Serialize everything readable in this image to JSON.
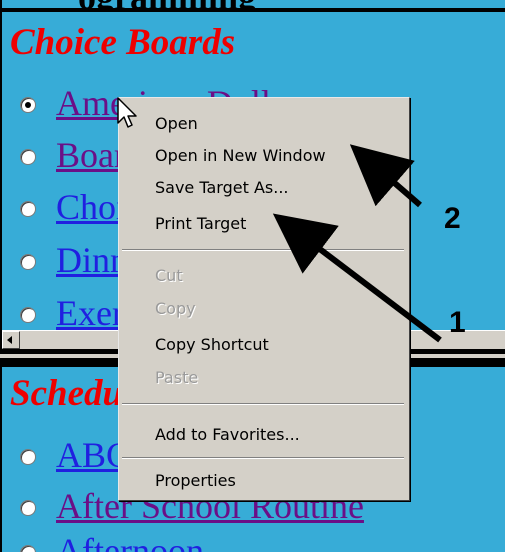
{
  "top_partial_text": "ogramming",
  "sections": [
    {
      "heading": "Choice Boards",
      "items": [
        {
          "label": "American Dolls",
          "selected": true,
          "visited": true
        },
        {
          "label": "Boards",
          "selected": false,
          "visited": true
        },
        {
          "label": "Choices",
          "selected": false,
          "visited": false
        },
        {
          "label": "Dinner",
          "selected": false,
          "visited": false
        },
        {
          "label": "Exercise",
          "selected": false,
          "visited": false
        }
      ]
    },
    {
      "heading": "Schedules",
      "items": [
        {
          "label": "ABC",
          "selected": false,
          "visited": false
        },
        {
          "label": "After School Routine",
          "selected": false,
          "visited": true
        },
        {
          "label": "Afternoon",
          "selected": false,
          "visited": false
        }
      ]
    }
  ],
  "context_menu": {
    "items": [
      {
        "label": "Open",
        "disabled": false
      },
      {
        "label": "Open in New Window",
        "disabled": false
      },
      {
        "label": "Save Target As...",
        "disabled": false
      },
      {
        "label": "Print Target",
        "disabled": false
      },
      {
        "label": "Cut",
        "disabled": true
      },
      {
        "label": "Copy",
        "disabled": true
      },
      {
        "label": "Copy Shortcut",
        "disabled": false
      },
      {
        "label": "Paste",
        "disabled": true
      },
      {
        "label": "Add to Favorites...",
        "disabled": false
      },
      {
        "label": "Properties",
        "disabled": false
      }
    ]
  },
  "annotations": {
    "label_1": "1",
    "label_2": "2"
  },
  "colors": {
    "background": "#37acd7",
    "heading": "#ee0000",
    "link": "#2020e0",
    "link_visited": "#6b0f87",
    "menu_bg": "#d4d0c8"
  }
}
